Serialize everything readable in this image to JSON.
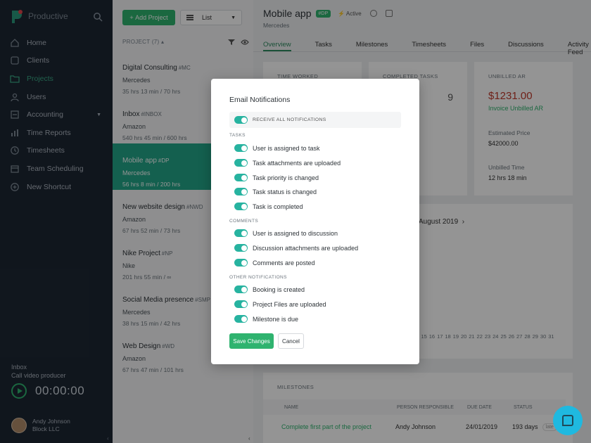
{
  "sidebar": {
    "brand": "Productive",
    "nav": [
      {
        "label": "Home",
        "icon": "home-icon"
      },
      {
        "label": "Clients",
        "icon": "clients-icon"
      },
      {
        "label": "Projects",
        "icon": "projects-icon"
      },
      {
        "label": "Users",
        "icon": "users-icon"
      },
      {
        "label": "Accounting",
        "icon": "accounting-icon"
      },
      {
        "label": "Time Reports",
        "icon": "bar-chart-icon"
      },
      {
        "label": "Timesheets",
        "icon": "clock-icon"
      },
      {
        "label": "Team Scheduling",
        "icon": "calendar-icon"
      },
      {
        "label": "New Shortcut",
        "icon": "plus-circle-icon"
      }
    ],
    "inbox_label": "Inbox",
    "inbox_task": "Call video producer",
    "timer": "00:00:00",
    "user_name": "Andy Johnson",
    "user_company": "Block LLC"
  },
  "projlist": {
    "add_label": "Add Project",
    "view_select": "List",
    "header": "PROJECT (7) ▴",
    "projects": [
      {
        "name": "Digital Consulting",
        "code": "#MC",
        "client": "Mercedes",
        "hours": "35 hrs 13 min / 70 hrs"
      },
      {
        "name": "Inbox",
        "code": "#INBOX",
        "client": "Amazon",
        "hours": "540 hrs 45 min / 600 hrs"
      },
      {
        "name": "Mobile app",
        "code": "#DP",
        "client": "Mercedes",
        "hours": "56 hrs 8 min / 200 hrs"
      },
      {
        "name": "New website design",
        "code": "#NWD",
        "client": "Amazon",
        "hours": "67 hrs 52 min / 73 hrs"
      },
      {
        "name": "Nike Project",
        "code": "#NP",
        "client": "Nike",
        "hours": "201 hrs 55 min / ∞"
      },
      {
        "name": "Social Media presence",
        "code": "#SMP",
        "client": "Mercedes",
        "hours": "38 hrs 15 min / 42 hrs"
      },
      {
        "name": "Web Design",
        "code": "#WD",
        "client": "Amazon",
        "hours": "67 hrs 47 min / 101 hrs"
      }
    ]
  },
  "main": {
    "title": "Mobile app",
    "badge": "#DP",
    "status": "Active",
    "client": "Mercedes",
    "tabs": [
      "Overview",
      "Tasks",
      "Milestones",
      "Timesheets",
      "Files",
      "Discussions",
      "Activity Feed"
    ],
    "card_time_worked": "TIME WORKED",
    "card_completed_tasks": "COMPLETED TASKS",
    "completed_value": "9",
    "card_unbilled": "UNBILLED AR",
    "unbilled_value": "$1231.00",
    "unbilled_link": "Invoice Unbilled AR",
    "estimated_label": "Estimated Price",
    "estimated_value": "$42000.00",
    "unbilled_time_label": "Unbilled Time",
    "unbilled_time_value": "12 hrs 18 min",
    "month": "August 2019",
    "days": [
      "15",
      "16",
      "17",
      "18",
      "19",
      "20",
      "21",
      "22",
      "23",
      "24",
      "25",
      "26",
      "27",
      "28",
      "29",
      "30",
      "31"
    ],
    "milestones_title": "MILESTONES",
    "ms_cols": [
      "NAME",
      "PERSON RESPONSIBLE",
      "DUE DATE",
      "STATUS"
    ],
    "ms_row": {
      "name": "Complete first part of the project",
      "person": "Andy Johnson",
      "due": "24/01/2019",
      "status": "193 days",
      "tag": "late"
    }
  },
  "modal": {
    "title": "Email Notifications",
    "receive_all": "RECEIVE ALL NOTIFICATIONS",
    "sections": [
      {
        "title": "TASKS",
        "items": [
          "User is assigned to task",
          "Task attachments are uploaded",
          "Task priority is changed",
          "Task status is changed",
          "Task is completed"
        ]
      },
      {
        "title": "COMMENTS",
        "items": [
          "User is assigned to discussion",
          "Discussion attachments are uploaded",
          "Comments are posted"
        ]
      },
      {
        "title": "OTHER NOTIFICATIONS",
        "items": [
          "Booking is created",
          "Project Files are uploaded",
          "Milestone is due"
        ]
      }
    ],
    "save_label": "Save Changes",
    "cancel_label": "Cancel"
  }
}
